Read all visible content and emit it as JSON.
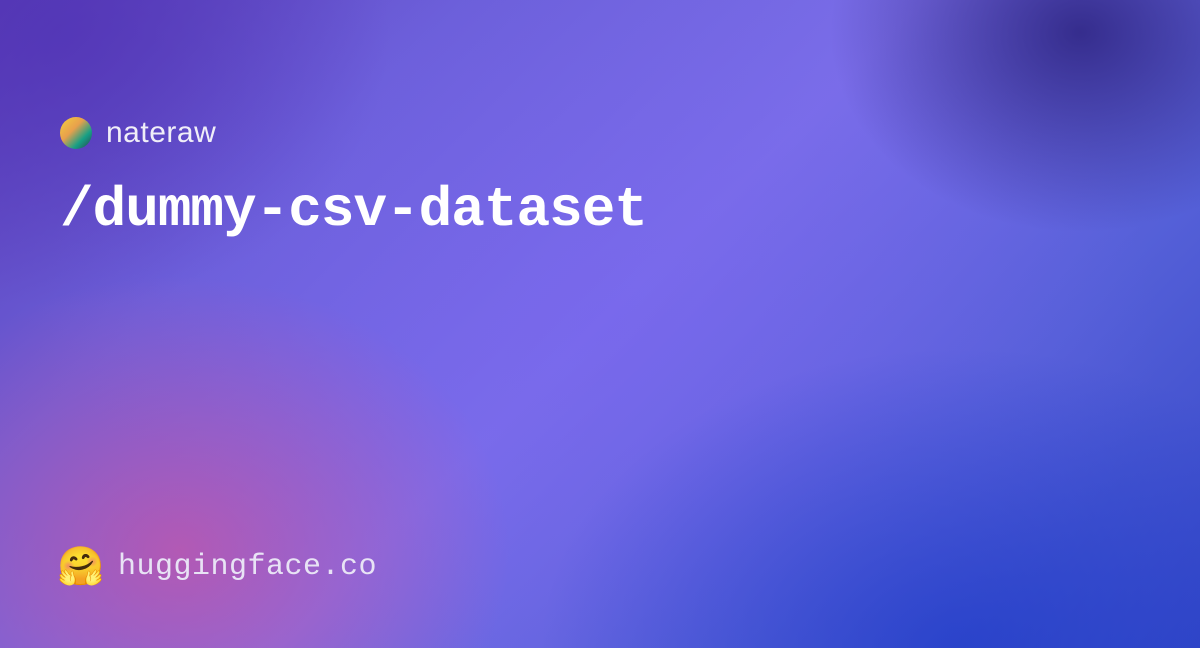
{
  "user": {
    "name": "nateraw"
  },
  "repo": {
    "path": "/dummy-csv-dataset"
  },
  "footer": {
    "domain": "huggingface.co",
    "logo_emoji": "🤗"
  }
}
